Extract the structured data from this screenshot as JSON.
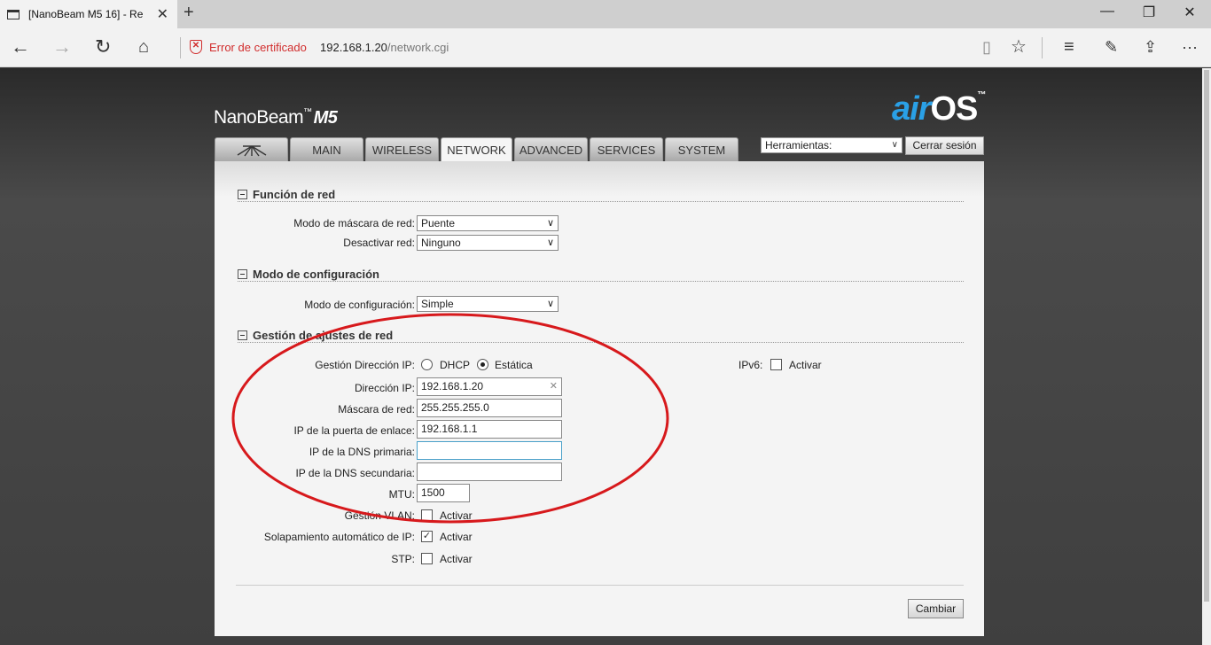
{
  "browser": {
    "tab_title": "[NanoBeam M5 16] - Re",
    "cert_error": "Error de certificado",
    "url_host": "192.168.1.20",
    "url_path": "/network.cgi"
  },
  "header": {
    "brand": "NanoBeam",
    "brand_tm": "™",
    "brand_model": "M5",
    "airos_air": "air",
    "airos_os": "OS",
    "airos_tm": "™"
  },
  "tabs": [
    "MAIN",
    "WIRELESS",
    "NETWORK",
    "ADVANCED",
    "SERVICES",
    "SYSTEM"
  ],
  "tools": {
    "select_value": "Herramientas:",
    "logout": "Cerrar sesión"
  },
  "network_role": {
    "title": "Función de red",
    "mode_label": "Modo de máscara de red:",
    "mode_value": "Puente",
    "disable_label": "Desactivar red:",
    "disable_value": "Ninguno"
  },
  "config_mode": {
    "title": "Modo de configuración",
    "label": "Modo de configuración:",
    "value": "Simple"
  },
  "net_settings": {
    "title": "Gestión de ajustes de red",
    "ip_mgmt_label": "Gestión Dirección IP:",
    "dhcp": "DHCP",
    "static": "Estática",
    "ip_label": "Dirección IP:",
    "ip_value": "192.168.1.20",
    "mask_label": "Máscara de red:",
    "mask_value": "255.255.255.0",
    "gw_label": "IP de la puerta de enlace:",
    "gw_value": "192.168.1.1",
    "dns1_label": "IP de la DNS primaria:",
    "dns1_value": "",
    "dns2_label": "IP de la DNS secundaria:",
    "dns2_value": "",
    "mtu_label": "MTU:",
    "mtu_value": "1500",
    "vlan_label": "Gestión VLAN:",
    "vlan_opt": "Activar",
    "alias_label": "Solapamiento automático de IP:",
    "alias_opt": "Activar",
    "stp_label": "STP:",
    "stp_opt": "Activar",
    "ipv6_label": "IPv6:",
    "ipv6_opt": "Activar"
  },
  "footer": {
    "change": "Cambiar"
  },
  "colors": {
    "annotation": "#d7191c",
    "airos_accent": "#2aa0e6",
    "cert_error": "#d12d2d"
  }
}
